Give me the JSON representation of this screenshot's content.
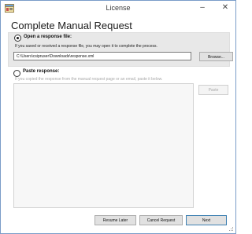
{
  "window": {
    "title": "License",
    "minimize_icon": "minimize-icon",
    "close_icon": "close-icon"
  },
  "heading": "Complete Manual Request",
  "response_file": {
    "label": "Open a response file:",
    "help": "If you saved or received a response file, you may open it to complete the process.",
    "path": "C:\\Users\\csipruser\\Downloads\\response.xml",
    "browse_label": "Browse...",
    "selected": true
  },
  "paste_response": {
    "label": "Paste response:",
    "help": "If you copied the response from the manual request page or an email, paste it below.",
    "text": "",
    "paste_label": "Paste",
    "selected": false
  },
  "buttons": {
    "resume_later": "Resume Later",
    "cancel_request": "Cancel Request",
    "next": "Next"
  }
}
